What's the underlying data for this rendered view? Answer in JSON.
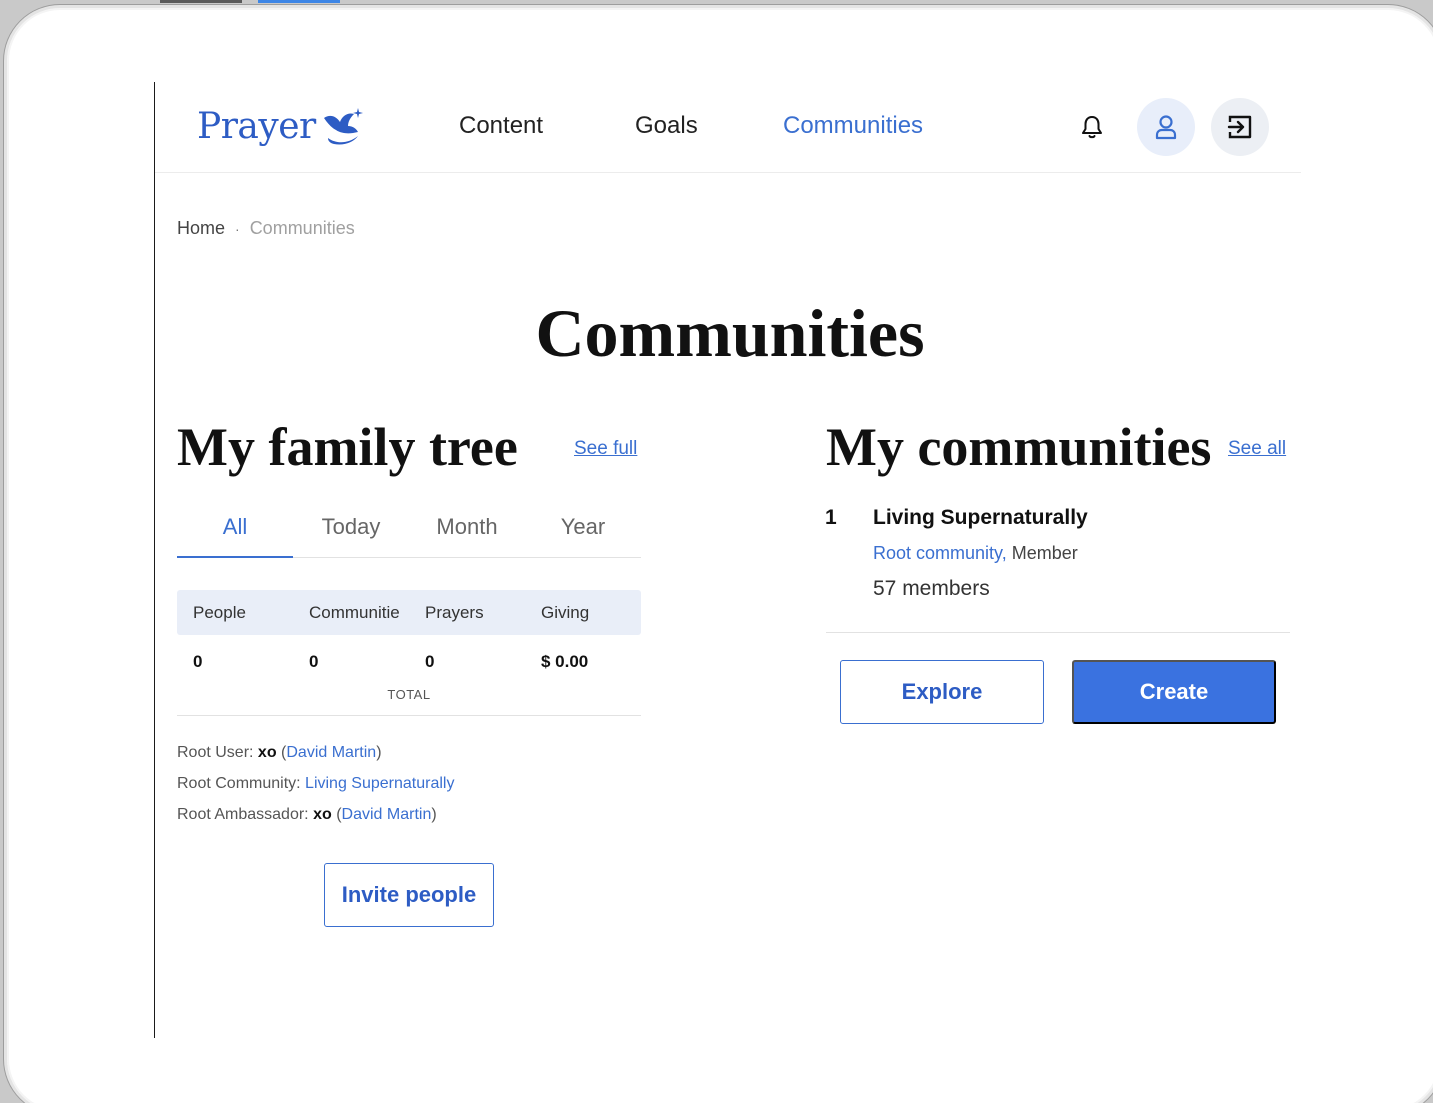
{
  "header": {
    "logo_text": "Prayer",
    "nav": [
      {
        "label": "Content"
      },
      {
        "label": "Goals"
      },
      {
        "label": "Communities"
      }
    ],
    "icons": [
      "bell-icon",
      "user-icon",
      "logout-icon"
    ],
    "accent_color": "#3a6fd0"
  },
  "breadcrumb": {
    "home": "Home",
    "separator": "·",
    "current": "Communities"
  },
  "page_title": "Communities",
  "family_tree": {
    "title": "My family tree",
    "see_full": "See full",
    "tabs": [
      "All",
      "Today",
      "Month",
      "Year"
    ],
    "active_tab": "All",
    "columns": [
      "People",
      "Communitie",
      "Prayers",
      "Giving"
    ],
    "values": [
      "0",
      "0",
      "0",
      "$ 0.00"
    ],
    "total_label": "TOTAL",
    "root_user_label": "Root User:",
    "root_user_name": "xo",
    "root_user_link": "David Martin",
    "root_community_label": "Root Community:",
    "root_community_link": "Living Supernaturally",
    "root_ambassador_label": "Root Ambassador:",
    "root_ambassador_name": "xo",
    "root_ambassador_link": "David Martin",
    "invite_button": "Invite people"
  },
  "my_communities": {
    "title": "My communities",
    "see_all": "See all",
    "items": [
      {
        "index": "1",
        "name": "Living Supernaturally",
        "type": "Root community,",
        "role": "Member",
        "members": "57 members"
      }
    ],
    "explore_button": "Explore",
    "create_button": "Create"
  }
}
